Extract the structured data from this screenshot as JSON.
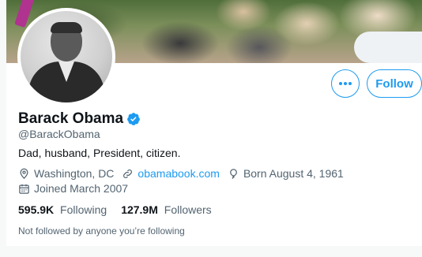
{
  "profile": {
    "name": "Barack Obama",
    "handle": "@BarackObama",
    "bio": "Dad, husband, President, citizen.",
    "location": "Washington, DC",
    "website": "obamabook.com",
    "birthday": "Born August 4, 1961",
    "joined": "Joined March 2007",
    "verified": true
  },
  "stats": {
    "following_count": "595.9K",
    "following_label": "Following",
    "followers_count": "127.9M",
    "followers_label": "Followers"
  },
  "followed_by_text": "Not followed by anyone you’re following",
  "actions": {
    "follow_label": "Follow",
    "more_icon": "more-horizontal-icon"
  },
  "icons": {
    "location": "location-pin-icon",
    "website": "link-icon",
    "birthday": "balloon-icon",
    "joined": "calendar-icon",
    "verified": "verified-badge-icon"
  },
  "colors": {
    "accent": "#1d9bf0",
    "text_primary": "#0f1419",
    "text_secondary": "#536471"
  }
}
